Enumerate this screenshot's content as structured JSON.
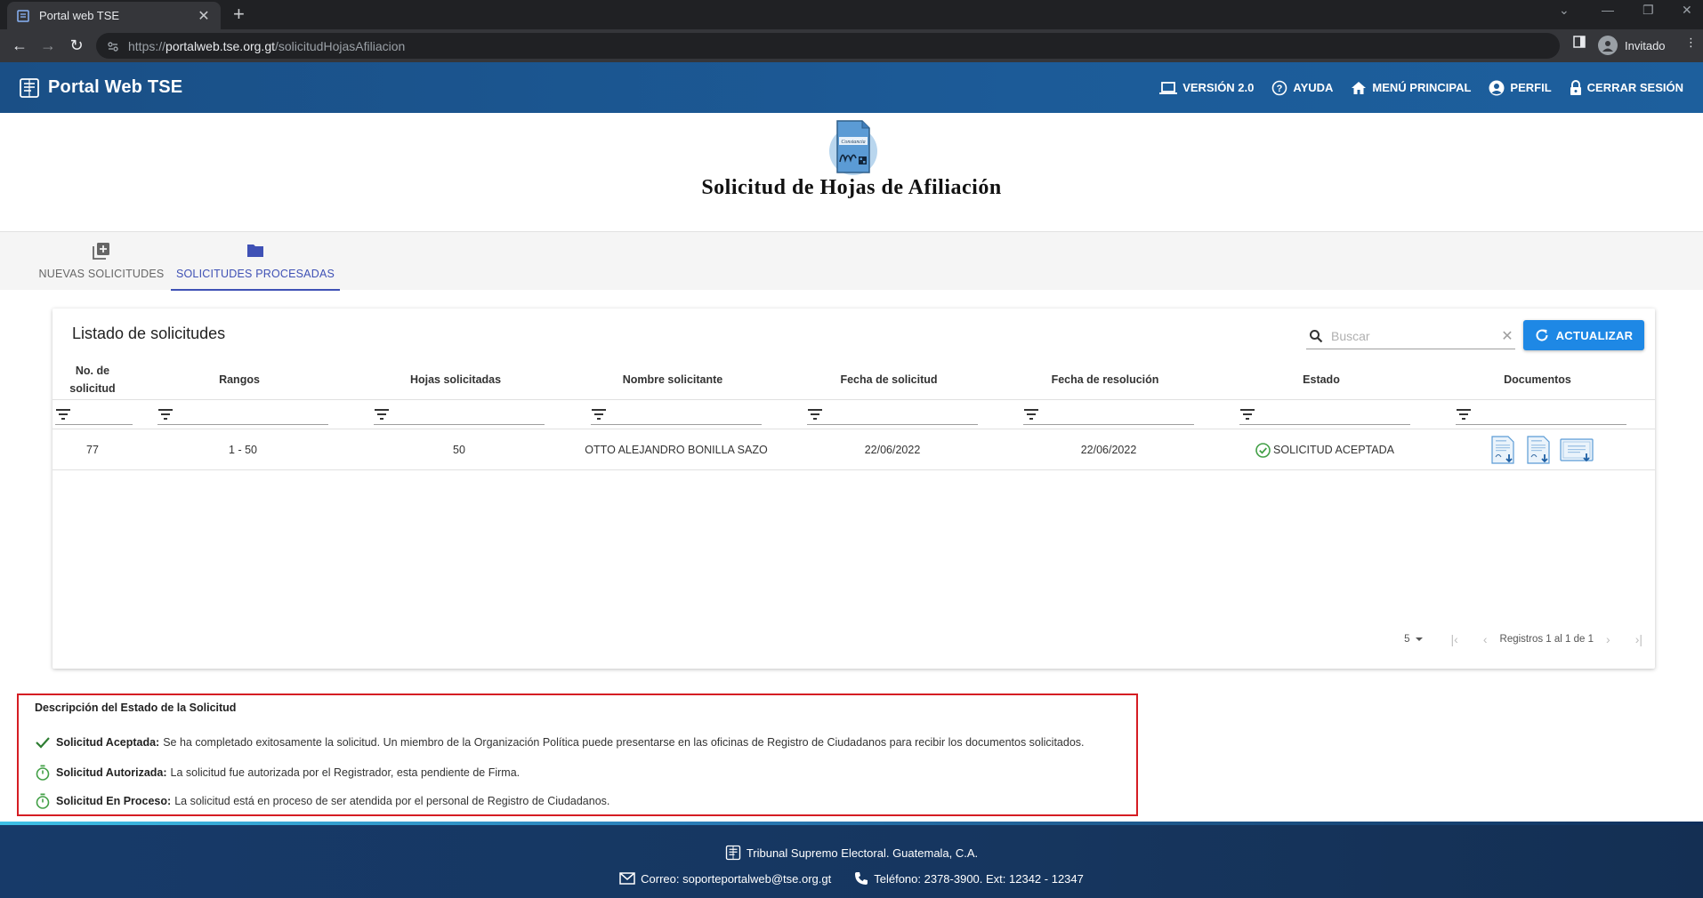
{
  "browser": {
    "tab_title": "Portal web TSE",
    "url_scheme": "https://",
    "url_host": "portalweb.tse.org.gt",
    "url_path": "/solicitudHojasAfiliacion",
    "profile_label": "Invitado"
  },
  "appbar": {
    "brand": "Portal Web TSE",
    "menu": [
      {
        "label": "VERSIÓN 2.0",
        "icon": "laptop-icon"
      },
      {
        "label": "AYUDA",
        "icon": "help-icon"
      },
      {
        "label": "MENÚ PRINCIPAL",
        "icon": "home-icon"
      },
      {
        "label": "PERFIL",
        "icon": "account-icon"
      },
      {
        "label": "CERRAR SESIÓN",
        "icon": "lock-icon"
      }
    ]
  },
  "page": {
    "title": "Solicitud de Hojas de Afiliación"
  },
  "tabs": [
    {
      "label": "NUEVAS SOLICITUDES",
      "icon": "add-box-icon",
      "active": false
    },
    {
      "label": "SOLICITUDES PROCESADAS",
      "icon": "folder-icon",
      "active": true
    }
  ],
  "listing": {
    "title": "Listado de solicitudes",
    "search_placeholder": "Buscar",
    "refresh_label": "ACTUALIZAR",
    "columns": [
      "No. de solicitud",
      "Rangos",
      "Hojas solicitadas",
      "Nombre solicitante",
      "Fecha de solicitud",
      "Fecha de resolución",
      "Estado",
      "Documentos"
    ],
    "rows": [
      {
        "numero": "77",
        "rangos": "1 - 50",
        "hojas": "50",
        "nombre": "OTTO ALEJANDRO BONILLA SAZO",
        "fecha_solicitud": "22/06/2022",
        "fecha_resolucion": "22/06/2022",
        "estado": "SOLICITUD ACEPTADA",
        "documentos": [
          "document-download-icon",
          "document-download-icon",
          "certificate-download-icon"
        ]
      }
    ],
    "pager": {
      "page_size": "5",
      "range_text": "Registros 1 al 1 de 1"
    }
  },
  "legend": {
    "title": "Descripción del Estado de la Solicitud",
    "items": [
      {
        "icon": "check-icon",
        "name": "Solicitud Aceptada:",
        "text": "Se ha completado exitosamente la solicitud. Un miembro de la Organización Política puede presentarse en las oficinas de Registro de Ciudadanos para recibir los documentos solicitados."
      },
      {
        "icon": "timer-icon",
        "name": "Solicitud Autorizada:",
        "text": "La solicitud fue autorizada por el Registrador, esta pendiente de Firma."
      },
      {
        "icon": "timer-icon",
        "name": "Solicitud En Proceso:",
        "text": "La solicitud está en proceso de ser atendida por el personal de Registro de Ciudadanos."
      }
    ]
  },
  "footer": {
    "org": "Tribunal Supremo Electoral. Guatemala, C.A.",
    "email": "Correo: soporteportalweb@tse.org.gt",
    "phone": "Teléfono: 2378-3900. Ext: 12342 - 12347"
  },
  "colors": {
    "primary": "#1d5a97",
    "accent_button": "#1e88e5",
    "tab_active": "#3f51b5",
    "success": "#43a047",
    "legend_border": "#d51d23"
  }
}
